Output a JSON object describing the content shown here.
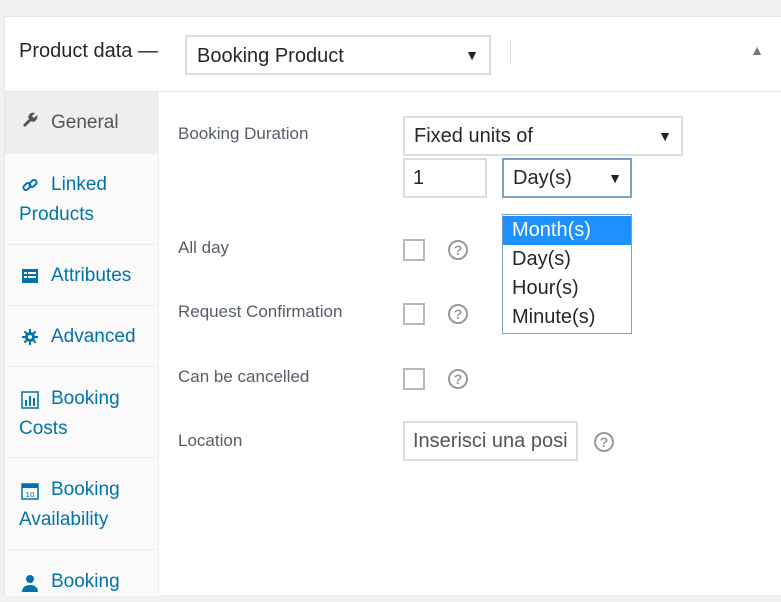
{
  "header": {
    "title": "Product data —",
    "product_type": "Booking Product"
  },
  "sidebar": {
    "tabs": [
      {
        "icon": "wrench-icon",
        "line1": "General",
        "line2": ""
      },
      {
        "icon": "link-icon",
        "line1": "Linked",
        "line2": "Products"
      },
      {
        "icon": "list-icon",
        "line1": "Attributes",
        "line2": ""
      },
      {
        "icon": "gear-icon",
        "line1": "Advanced",
        "line2": ""
      },
      {
        "icon": "chart-icon",
        "line1": "Booking",
        "line2": "Costs"
      },
      {
        "icon": "calendar-icon",
        "line1": "Booking",
        "line2": "Availability"
      },
      {
        "icon": "person-icon",
        "line1": "Booking",
        "line2": ""
      }
    ]
  },
  "form": {
    "booking_duration": {
      "label": "Booking Duration",
      "type_value": "Fixed units of",
      "units_value": "1",
      "unit_selected": "Day(s)",
      "options": [
        "Month(s)",
        "Day(s)",
        "Hour(s)",
        "Minute(s)"
      ],
      "highlighted_option": "Month(s)"
    },
    "all_day": {
      "label": "All day"
    },
    "request_confirmation": {
      "label": "Request Confirmation"
    },
    "can_be_cancelled": {
      "label": "Can be cancelled"
    },
    "location": {
      "label": "Location",
      "placeholder": "Inserisci una posi"
    }
  },
  "colors": {
    "link": "#0073aa",
    "highlight": "#1e90ff",
    "active_tab_bg": "#eeeeee"
  }
}
